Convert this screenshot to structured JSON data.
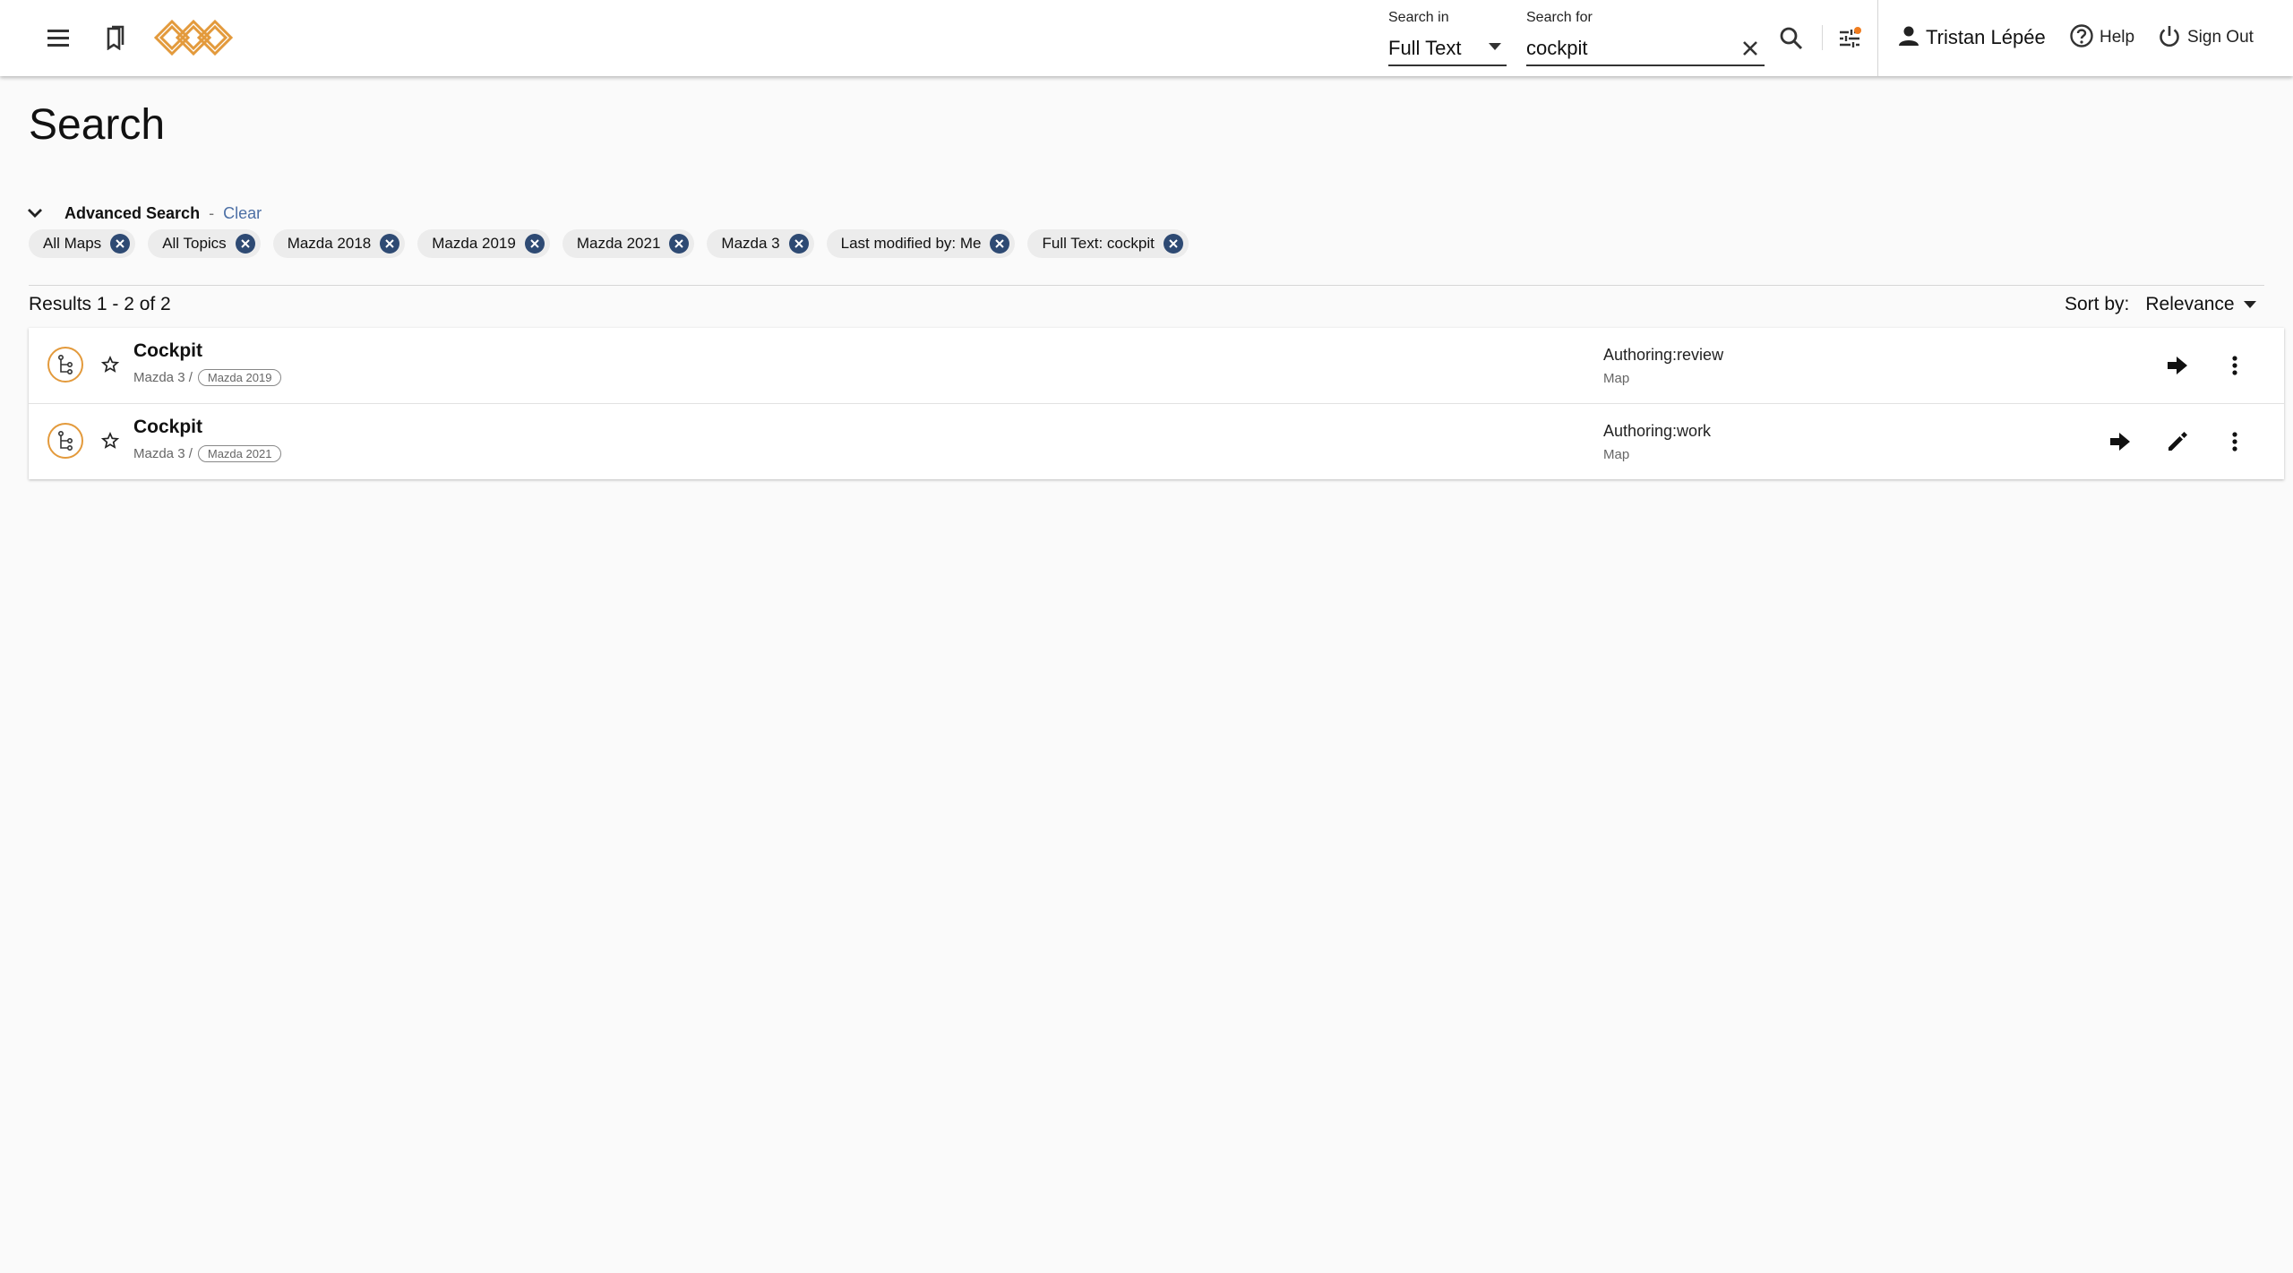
{
  "header": {
    "search_in_label": "Search in",
    "search_in_value": "Full Text",
    "search_for_label": "Search for",
    "search_for_value": "cockpit",
    "user_name": "Tristan Lépée",
    "help_label": "Help",
    "signout_label": "Sign Out"
  },
  "page": {
    "title": "Search"
  },
  "advanced": {
    "title": "Advanced Search",
    "separator": "-",
    "clear_label": "Clear",
    "chips": [
      {
        "label": "All Maps"
      },
      {
        "label": "All Topics"
      },
      {
        "label": "Mazda 2018"
      },
      {
        "label": "Mazda 2019"
      },
      {
        "label": "Mazda 2021"
      },
      {
        "label": "Mazda 3"
      },
      {
        "label": "Last modified by: Me"
      },
      {
        "label": "Full Text: cockpit"
      }
    ]
  },
  "results": {
    "summary": "Results 1 - 2 of 2",
    "sort_label": "Sort by:",
    "sort_value": "Relevance",
    "items": [
      {
        "title": "Cockpit",
        "path": "Mazda 3 /",
        "tag": "Mazda 2019",
        "status": "Authoring:review",
        "type": "Map"
      },
      {
        "title": "Cockpit",
        "path": "Mazda 3 /",
        "tag": "Mazda 2021",
        "status": "Authoring:work",
        "type": "Map"
      }
    ]
  },
  "icons": {
    "menu": "menu-icon",
    "bookmarks": "bookmarks-icon",
    "logo": "logo",
    "search": "search-icon",
    "filter": "filter-settings-icon",
    "user": "person-icon",
    "help": "help-circle-icon",
    "signout": "power-icon",
    "map": "map-tree-icon",
    "star": "star-outline-icon",
    "open": "arrow-right-icon",
    "edit": "pencil-icon",
    "more": "more-vertical-icon"
  },
  "colors": {
    "accent": "#e39a3c",
    "chip_close": "#2e4a73",
    "link": "#4c6fa5",
    "notification_dot": "#f07c1e"
  }
}
